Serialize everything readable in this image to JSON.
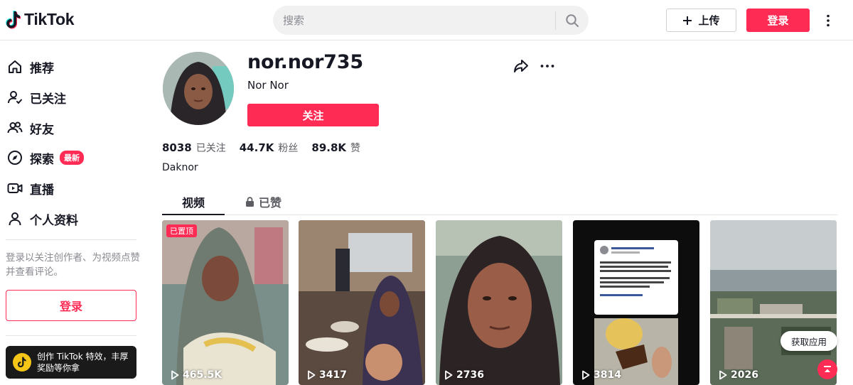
{
  "header": {
    "logo_text": "TikTok",
    "search_placeholder": "搜索",
    "upload_label": "上传",
    "login_label": "登录"
  },
  "sidebar": {
    "items": [
      {
        "label": "推荐",
        "icon": "home-icon"
      },
      {
        "label": "已关注",
        "icon": "following-icon"
      },
      {
        "label": "好友",
        "icon": "friends-icon"
      },
      {
        "label": "探索",
        "icon": "compass-icon",
        "badge": "最新"
      },
      {
        "label": "直播",
        "icon": "live-icon"
      },
      {
        "label": "个人资料",
        "icon": "profile-icon"
      }
    ],
    "login_hint": "登录以关注创作者、为视频点赞并查看评论。",
    "login_button": "登录",
    "creator_banner": "创作 TikTok 特效，丰厚奖励等你拿"
  },
  "profile": {
    "username": "nor.nor735",
    "nickname": "Nor Nor",
    "follow_button": "关注",
    "stats": [
      {
        "value": "8038",
        "label": "已关注"
      },
      {
        "value": "44.7K",
        "label": "粉丝"
      },
      {
        "value": "89.8K",
        "label": "赞"
      }
    ],
    "bio": "Daknor"
  },
  "tabs": {
    "videos": "视频",
    "liked": "已赞"
  },
  "videos": [
    {
      "views": "465.5K",
      "pinned": "已置顶"
    },
    {
      "views": "3417"
    },
    {
      "views": "2736"
    },
    {
      "views": "3814"
    },
    {
      "views": "2026"
    }
  ],
  "floating": {
    "get_app": "获取应用"
  },
  "colors": {
    "accent": "#fe2c55",
    "text_primary": "#161823",
    "text_secondary": "#8a8b91"
  }
}
